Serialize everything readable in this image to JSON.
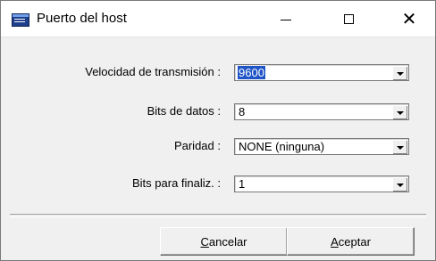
{
  "window": {
    "title": "Puerto del host",
    "icon": "terminal-app-icon"
  },
  "titlebar": {
    "minimize_icon": "minimize-icon",
    "maximize_icon": "maximize-icon",
    "close_icon": "close-icon",
    "close_glyph": "✕"
  },
  "fields": {
    "baud": {
      "label": "Velocidad de transmisión :",
      "value": "9600"
    },
    "data_bits": {
      "label": "Bits de datos :",
      "value": "8"
    },
    "parity": {
      "label": "Paridad :",
      "value": "NONE (ninguna)"
    },
    "stop_bits": {
      "label": "Bits para finaliz. :",
      "value": "1"
    }
  },
  "buttons": {
    "cancel": {
      "accel": "C",
      "rest": "ancelar"
    },
    "ok": {
      "accel": "A",
      "rest": "ceptar"
    }
  },
  "colors": {
    "selection": "#1f55c7",
    "dialog_bg": "#f0f0f0"
  }
}
